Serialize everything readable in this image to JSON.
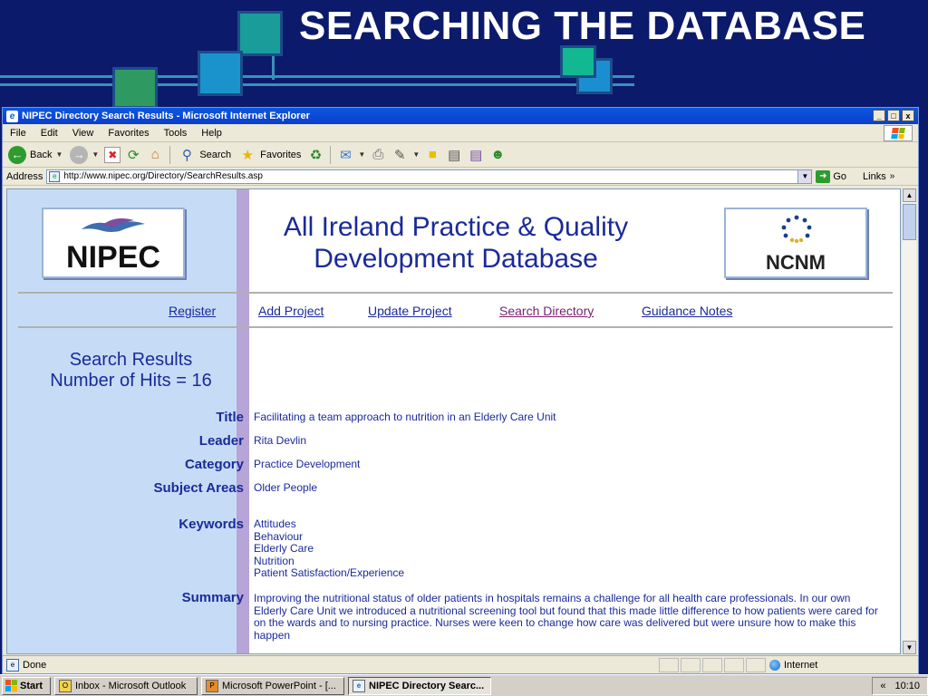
{
  "slide": {
    "title": "SEARCHING THE DATABASE"
  },
  "window": {
    "title": "NIPEC Directory Search Results - Microsoft Internet Explorer",
    "min": "_",
    "max": "□",
    "close": "x"
  },
  "menu": [
    "File",
    "Edit",
    "View",
    "Favorites",
    "Tools",
    "Help"
  ],
  "toolbar": {
    "back": "Back",
    "search": "Search",
    "favorites": "Favorites"
  },
  "address": {
    "label": "Address",
    "url": "http://www.nipec.org/Directory/SearchResults.asp",
    "go": "Go",
    "links": "Links"
  },
  "page": {
    "logo_left": "NIPEC",
    "logo_right": "NCNM",
    "site_title": [
      "All Ireland Practice & Quality",
      "Development Database"
    ],
    "nav": [
      "Register",
      "Add Project",
      "Update Project",
      "Search Directory",
      "Guidance Notes"
    ],
    "results_heading": "Search Results",
    "hits": "Number of Hits = 16",
    "fields": {
      "title_label": "Title",
      "title": "Facilitating a team approach to nutrition in an Elderly Care Unit",
      "leader_label": "Leader",
      "leader": "Rita Devlin",
      "category_label": "Category",
      "category": "Practice Development",
      "subject_label": "Subject Areas",
      "subject": "Older People",
      "keywords_label": "Keywords",
      "keywords": [
        "Attitudes",
        "Behaviour",
        "Elderly Care",
        "Nutrition",
        "Patient Satisfaction/Experience"
      ],
      "summary_label": "Summary",
      "summary": "Improving the nutritional status of older patients in hospitals remains a challenge for all health care professionals. In our own Elderly Care Unit we introduced a nutritional screening tool but found that this made little difference to how patients were cared for on the wards and to nursing practice. Nurses were keen to change how care was delivered but were unsure how to make this happen"
    }
  },
  "status": {
    "text": "Done",
    "zone": "Internet"
  },
  "taskbar": {
    "start": "Start",
    "tasks": [
      "Inbox - Microsoft Outlook",
      "Microsoft PowerPoint - [...",
      "NIPEC Directory Searc..."
    ],
    "clock": "10:10",
    "chevron": "«"
  },
  "colors": {
    "slide_bg": "#0b1a6b",
    "link": "#1a2a9a",
    "visited": "#7a1f6e",
    "left_column": "#c6dcf6",
    "stripe": "#b6a5d6"
  }
}
